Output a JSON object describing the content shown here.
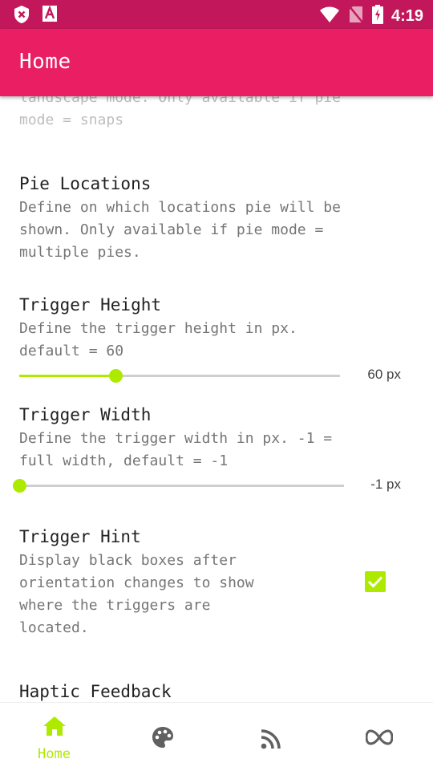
{
  "status_bar": {
    "time": "4:19"
  },
  "app_bar": {
    "title": "Home"
  },
  "colors": {
    "primary": "#e91e63",
    "primary_dark": "#c2185b",
    "accent": "#aeea00"
  },
  "prefs": {
    "partial_summary": "landscape mode. Only available if pie\nmode = snaps",
    "pie_locations": {
      "title": "Pie Locations",
      "summary": "Define on which locations pie will be\nshown. Only available if pie mode =\nmultiple pies."
    },
    "trigger_height": {
      "title": "Trigger Height",
      "summary": "Define the trigger height in px.\ndefault = 60",
      "value_label": "60 px",
      "value_fraction": 0.3
    },
    "trigger_width": {
      "title": "Trigger Width",
      "summary": "Define the trigger width in px. -1 =\nfull width, default = -1",
      "value_label": "-1 px",
      "value_fraction": 0.0
    },
    "trigger_hint": {
      "title": "Trigger Hint",
      "summary": "Display black boxes after\norientation changes to show\nwhere the triggers are\nlocated.",
      "checked": true
    },
    "haptic_feedback": {
      "title": "Haptic Feedback"
    }
  },
  "bottom_nav": {
    "items": [
      {
        "icon": "home-icon",
        "label": "Home",
        "active": true
      },
      {
        "icon": "palette-icon",
        "label": "",
        "active": false
      },
      {
        "icon": "rss-icon",
        "label": "",
        "active": false
      },
      {
        "icon": "infinity-icon",
        "label": "",
        "active": false
      }
    ]
  }
}
